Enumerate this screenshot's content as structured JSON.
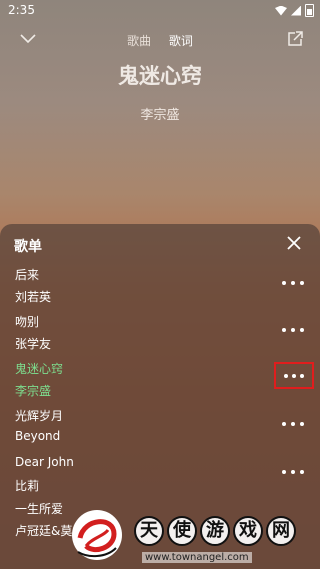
{
  "status_bar": {
    "time": "2:35"
  },
  "header": {
    "tabs": [
      {
        "label": "歌曲",
        "active": false
      },
      {
        "label": "歌词",
        "active": true
      }
    ]
  },
  "now_playing": {
    "title": "鬼迷心窍",
    "artist": "李宗盛"
  },
  "playlist": {
    "title": "歌单",
    "items": [
      {
        "name": "后来",
        "artist": "刘若英",
        "playing": false
      },
      {
        "name": "吻别",
        "artist": "张学友",
        "playing": false
      },
      {
        "name": "鬼迷心窍",
        "artist": "李宗盛",
        "playing": true
      },
      {
        "name": "光辉岁月",
        "artist": "Beyond",
        "playing": false
      },
      {
        "name": "Dear John",
        "artist": "比莉",
        "playing": false
      },
      {
        "name": "一生所爱",
        "artist": "卢冠廷&莫",
        "playing": false
      }
    ]
  },
  "watermark": {
    "chars": [
      "天",
      "使",
      "游",
      "戏",
      "网"
    ],
    "url": "www.townangel.com"
  },
  "colors": {
    "playing_text": "#7ddf8f",
    "highlight_box": "#e11d1d",
    "sheet_bg": "#56423a"
  },
  "icons": {
    "collapse": "chevron-down-icon",
    "share": "share-external-icon",
    "close": "close-icon",
    "more": "more-dots-icon"
  }
}
